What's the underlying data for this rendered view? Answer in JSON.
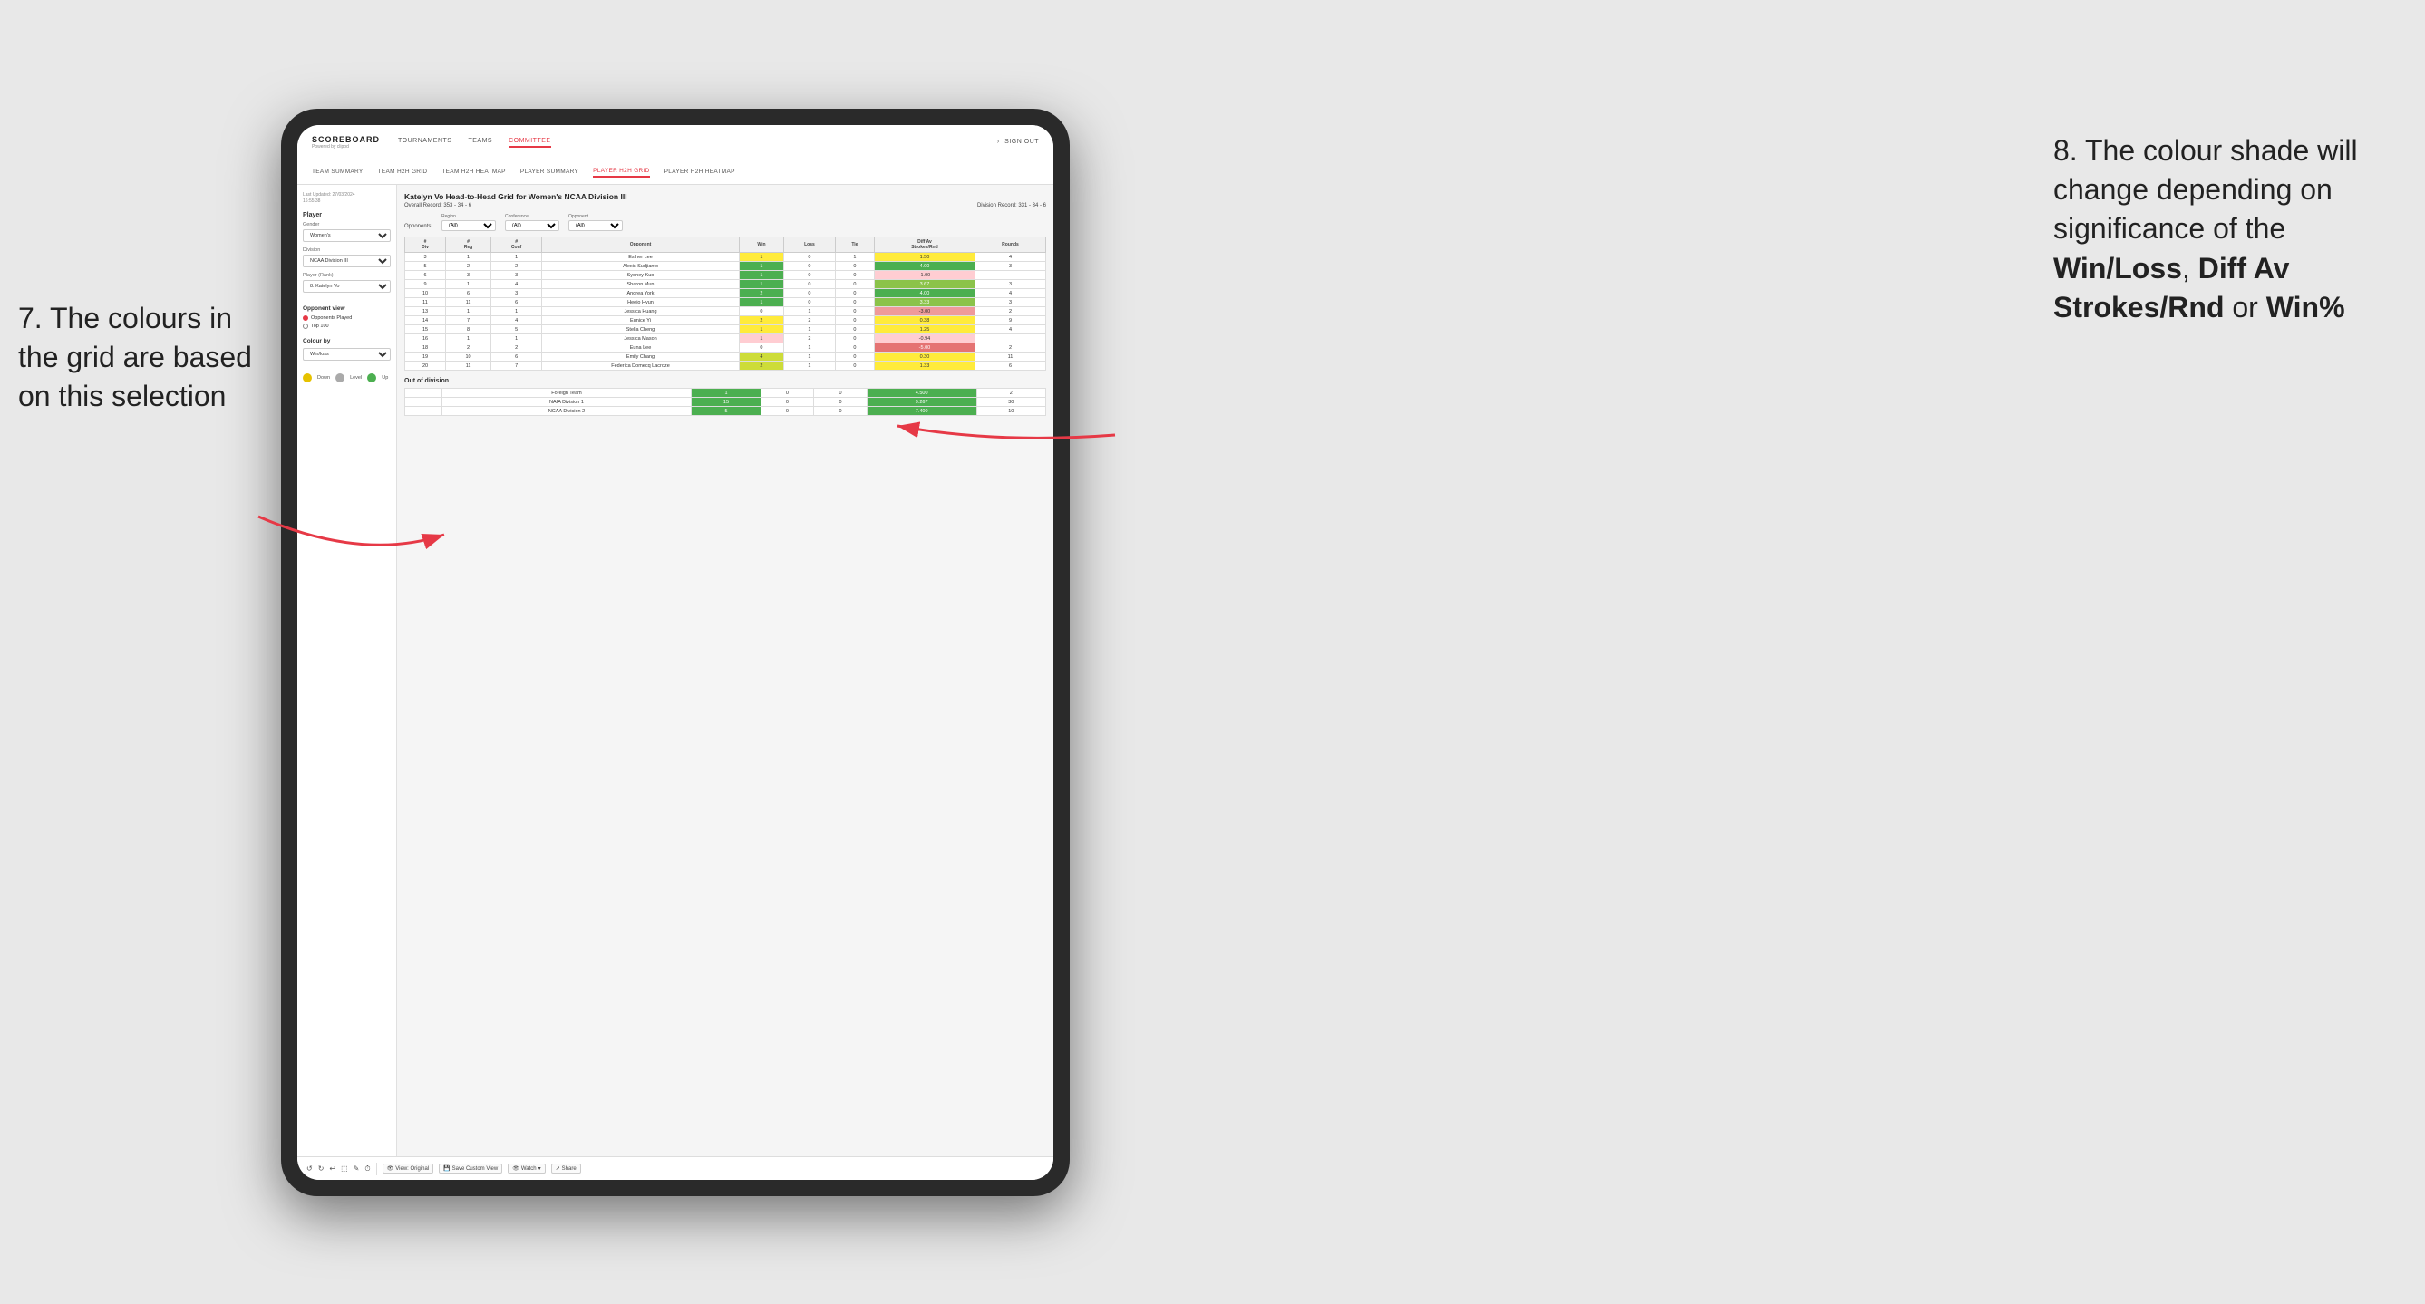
{
  "annotation_left": {
    "line1": "7. The colours in",
    "line2": "the grid are based",
    "line3": "on this selection"
  },
  "annotation_right": {
    "intro": "8. The colour shade will change depending on significance of the ",
    "bold1": "Win/Loss",
    "sep1": ", ",
    "bold2": "Diff Av Strokes/Rnd",
    "sep2": " or ",
    "bold3": "Win%"
  },
  "nav": {
    "logo": "SCOREBOARD",
    "logo_sub": "Powered by clippd",
    "items": [
      "TOURNAMENTS",
      "TEAMS",
      "COMMITTEE"
    ],
    "active_item": "COMMITTEE",
    "right": [
      "Sign out"
    ]
  },
  "sub_nav": {
    "items": [
      "TEAM SUMMARY",
      "TEAM H2H GRID",
      "TEAM H2H HEATMAP",
      "PLAYER SUMMARY",
      "PLAYER H2H GRID",
      "PLAYER H2H HEATMAP"
    ],
    "active": "PLAYER H2H GRID"
  },
  "left_panel": {
    "last_updated_label": "Last Updated: 27/03/2024",
    "last_updated_time": "16:55:38",
    "player_section": "Player",
    "gender_label": "Gender",
    "gender_value": "Women's",
    "division_label": "Division",
    "division_value": "NCAA Division III",
    "player_rank_label": "Player (Rank)",
    "player_rank_value": "8. Katelyn Vo",
    "opponent_view_title": "Opponent view",
    "radio1": "Opponents Played",
    "radio2": "Top 100",
    "colour_by_title": "Colour by",
    "colour_by_value": "Win/loss",
    "legend": [
      {
        "color": "#e6c200",
        "label": "Down"
      },
      {
        "color": "#aaaaaa",
        "label": "Level"
      },
      {
        "color": "#4caf50",
        "label": "Up"
      }
    ]
  },
  "grid": {
    "title": "Katelyn Vo Head-to-Head Grid for Women's NCAA Division III",
    "overall_record_label": "Overall Record:",
    "overall_record_value": "353 - 34 - 6",
    "division_record_label": "Division Record:",
    "division_record_value": "331 - 34 - 6",
    "filter_opponents_label": "Opponents:",
    "filter_region_label": "Region",
    "filter_region_value": "(All)",
    "filter_conference_label": "Conference",
    "filter_conference_value": "(All)",
    "filter_opponent_label": "Opponent",
    "filter_opponent_value": "(All)",
    "table_headers": [
      "#\nDiv",
      "#\nReg",
      "#\nConf",
      "Opponent",
      "Win",
      "Loss",
      "Tie",
      "Diff Av\nStrokes/Rnd",
      "Rounds"
    ],
    "rows": [
      {
        "div": "3",
        "reg": "1",
        "conf": "1",
        "opponent": "Esther Lee",
        "win": 1,
        "loss": 0,
        "tie": 1,
        "diff": "1.50",
        "rounds": 4,
        "win_color": "win-yellow",
        "diff_color": "win-yellow"
      },
      {
        "div": "5",
        "reg": "2",
        "conf": "2",
        "opponent": "Alexis Sudjianto",
        "win": 1,
        "loss": 0,
        "tie": 0,
        "diff": "4.00",
        "rounds": 3,
        "win_color": "win-green-dark",
        "diff_color": "win-green-dark"
      },
      {
        "div": "6",
        "reg": "3",
        "conf": "3",
        "opponent": "Sydney Kuo",
        "win": 1,
        "loss": 0,
        "tie": 0,
        "diff": "-1.00",
        "rounds": "",
        "win_color": "win-green-dark",
        "diff_color": "loss-red-light"
      },
      {
        "div": "9",
        "reg": "1",
        "conf": "4",
        "opponent": "Sharon Mun",
        "win": 1,
        "loss": 0,
        "tie": 0,
        "diff": "3.67",
        "rounds": 3,
        "win_color": "win-green-dark",
        "diff_color": "win-green-med"
      },
      {
        "div": "10",
        "reg": "6",
        "conf": "3",
        "opponent": "Andrea York",
        "win": 2,
        "loss": 0,
        "tie": 0,
        "diff": "4.00",
        "rounds": 4,
        "win_color": "win-green-dark",
        "diff_color": "win-green-dark"
      },
      {
        "div": "11",
        "reg": "11",
        "conf": "6",
        "opponent": "Heejo Hyun",
        "win": 1,
        "loss": 0,
        "tie": 0,
        "diff": "3.33",
        "rounds": 3,
        "win_color": "win-green-dark",
        "diff_color": "win-green-med"
      },
      {
        "div": "13",
        "reg": "1",
        "conf": "1",
        "opponent": "Jessica Huang",
        "win": 0,
        "loss": 1,
        "tie": 0,
        "diff": "-3.00",
        "rounds": 2,
        "win_color": "cell-empty",
        "diff_color": "loss-red"
      },
      {
        "div": "14",
        "reg": "7",
        "conf": "4",
        "opponent": "Eunice Yi",
        "win": 2,
        "loss": 2,
        "tie": 0,
        "diff": "0.38",
        "rounds": 9,
        "win_color": "win-yellow",
        "diff_color": "win-yellow"
      },
      {
        "div": "15",
        "reg": "8",
        "conf": "5",
        "opponent": "Stella Cheng",
        "win": 1,
        "loss": 1,
        "tie": 0,
        "diff": "1.25",
        "rounds": 4,
        "win_color": "win-yellow",
        "diff_color": "win-yellow"
      },
      {
        "div": "16",
        "reg": "1",
        "conf": "1",
        "opponent": "Jessica Mason",
        "win": 1,
        "loss": 2,
        "tie": 0,
        "diff": "-0.94",
        "rounds": "",
        "win_color": "loss-red-light",
        "diff_color": "loss-red-light"
      },
      {
        "div": "18",
        "reg": "2",
        "conf": "2",
        "opponent": "Euna Lee",
        "win": 0,
        "loss": 1,
        "tie": 0,
        "diff": "-5.00",
        "rounds": 2,
        "win_color": "cell-empty",
        "diff_color": "loss-red-dark"
      },
      {
        "div": "19",
        "reg": "10",
        "conf": "6",
        "opponent": "Emily Chang",
        "win": 4,
        "loss": 1,
        "tie": 0,
        "diff": "0.30",
        "rounds": 11,
        "win_color": "win-green-light",
        "diff_color": "win-yellow"
      },
      {
        "div": "20",
        "reg": "11",
        "conf": "7",
        "opponent": "Federica Domecq Lacroze",
        "win": 2,
        "loss": 1,
        "tie": 0,
        "diff": "1.33",
        "rounds": 6,
        "win_color": "win-green-light",
        "diff_color": "win-yellow"
      }
    ],
    "out_of_division_title": "Out of division",
    "out_of_division_rows": [
      {
        "opponent": "Foreign Team",
        "win": 1,
        "loss": 0,
        "tie": 0,
        "diff": "4.500",
        "rounds": 2,
        "win_color": "win-green-dark",
        "diff_color": "win-green-dark"
      },
      {
        "opponent": "NAIA Division 1",
        "win": 15,
        "loss": 0,
        "tie": 0,
        "diff": "9.267",
        "rounds": 30,
        "win_color": "win-green-dark",
        "diff_color": "win-green-dark"
      },
      {
        "opponent": "NCAA Division 2",
        "win": 5,
        "loss": 0,
        "tie": 0,
        "diff": "7.400",
        "rounds": 10,
        "win_color": "win-green-dark",
        "diff_color": "win-green-dark"
      }
    ]
  },
  "toolbar": {
    "view_original": "View: Original",
    "save_custom": "Save Custom View",
    "watch": "Watch",
    "share": "Share"
  }
}
